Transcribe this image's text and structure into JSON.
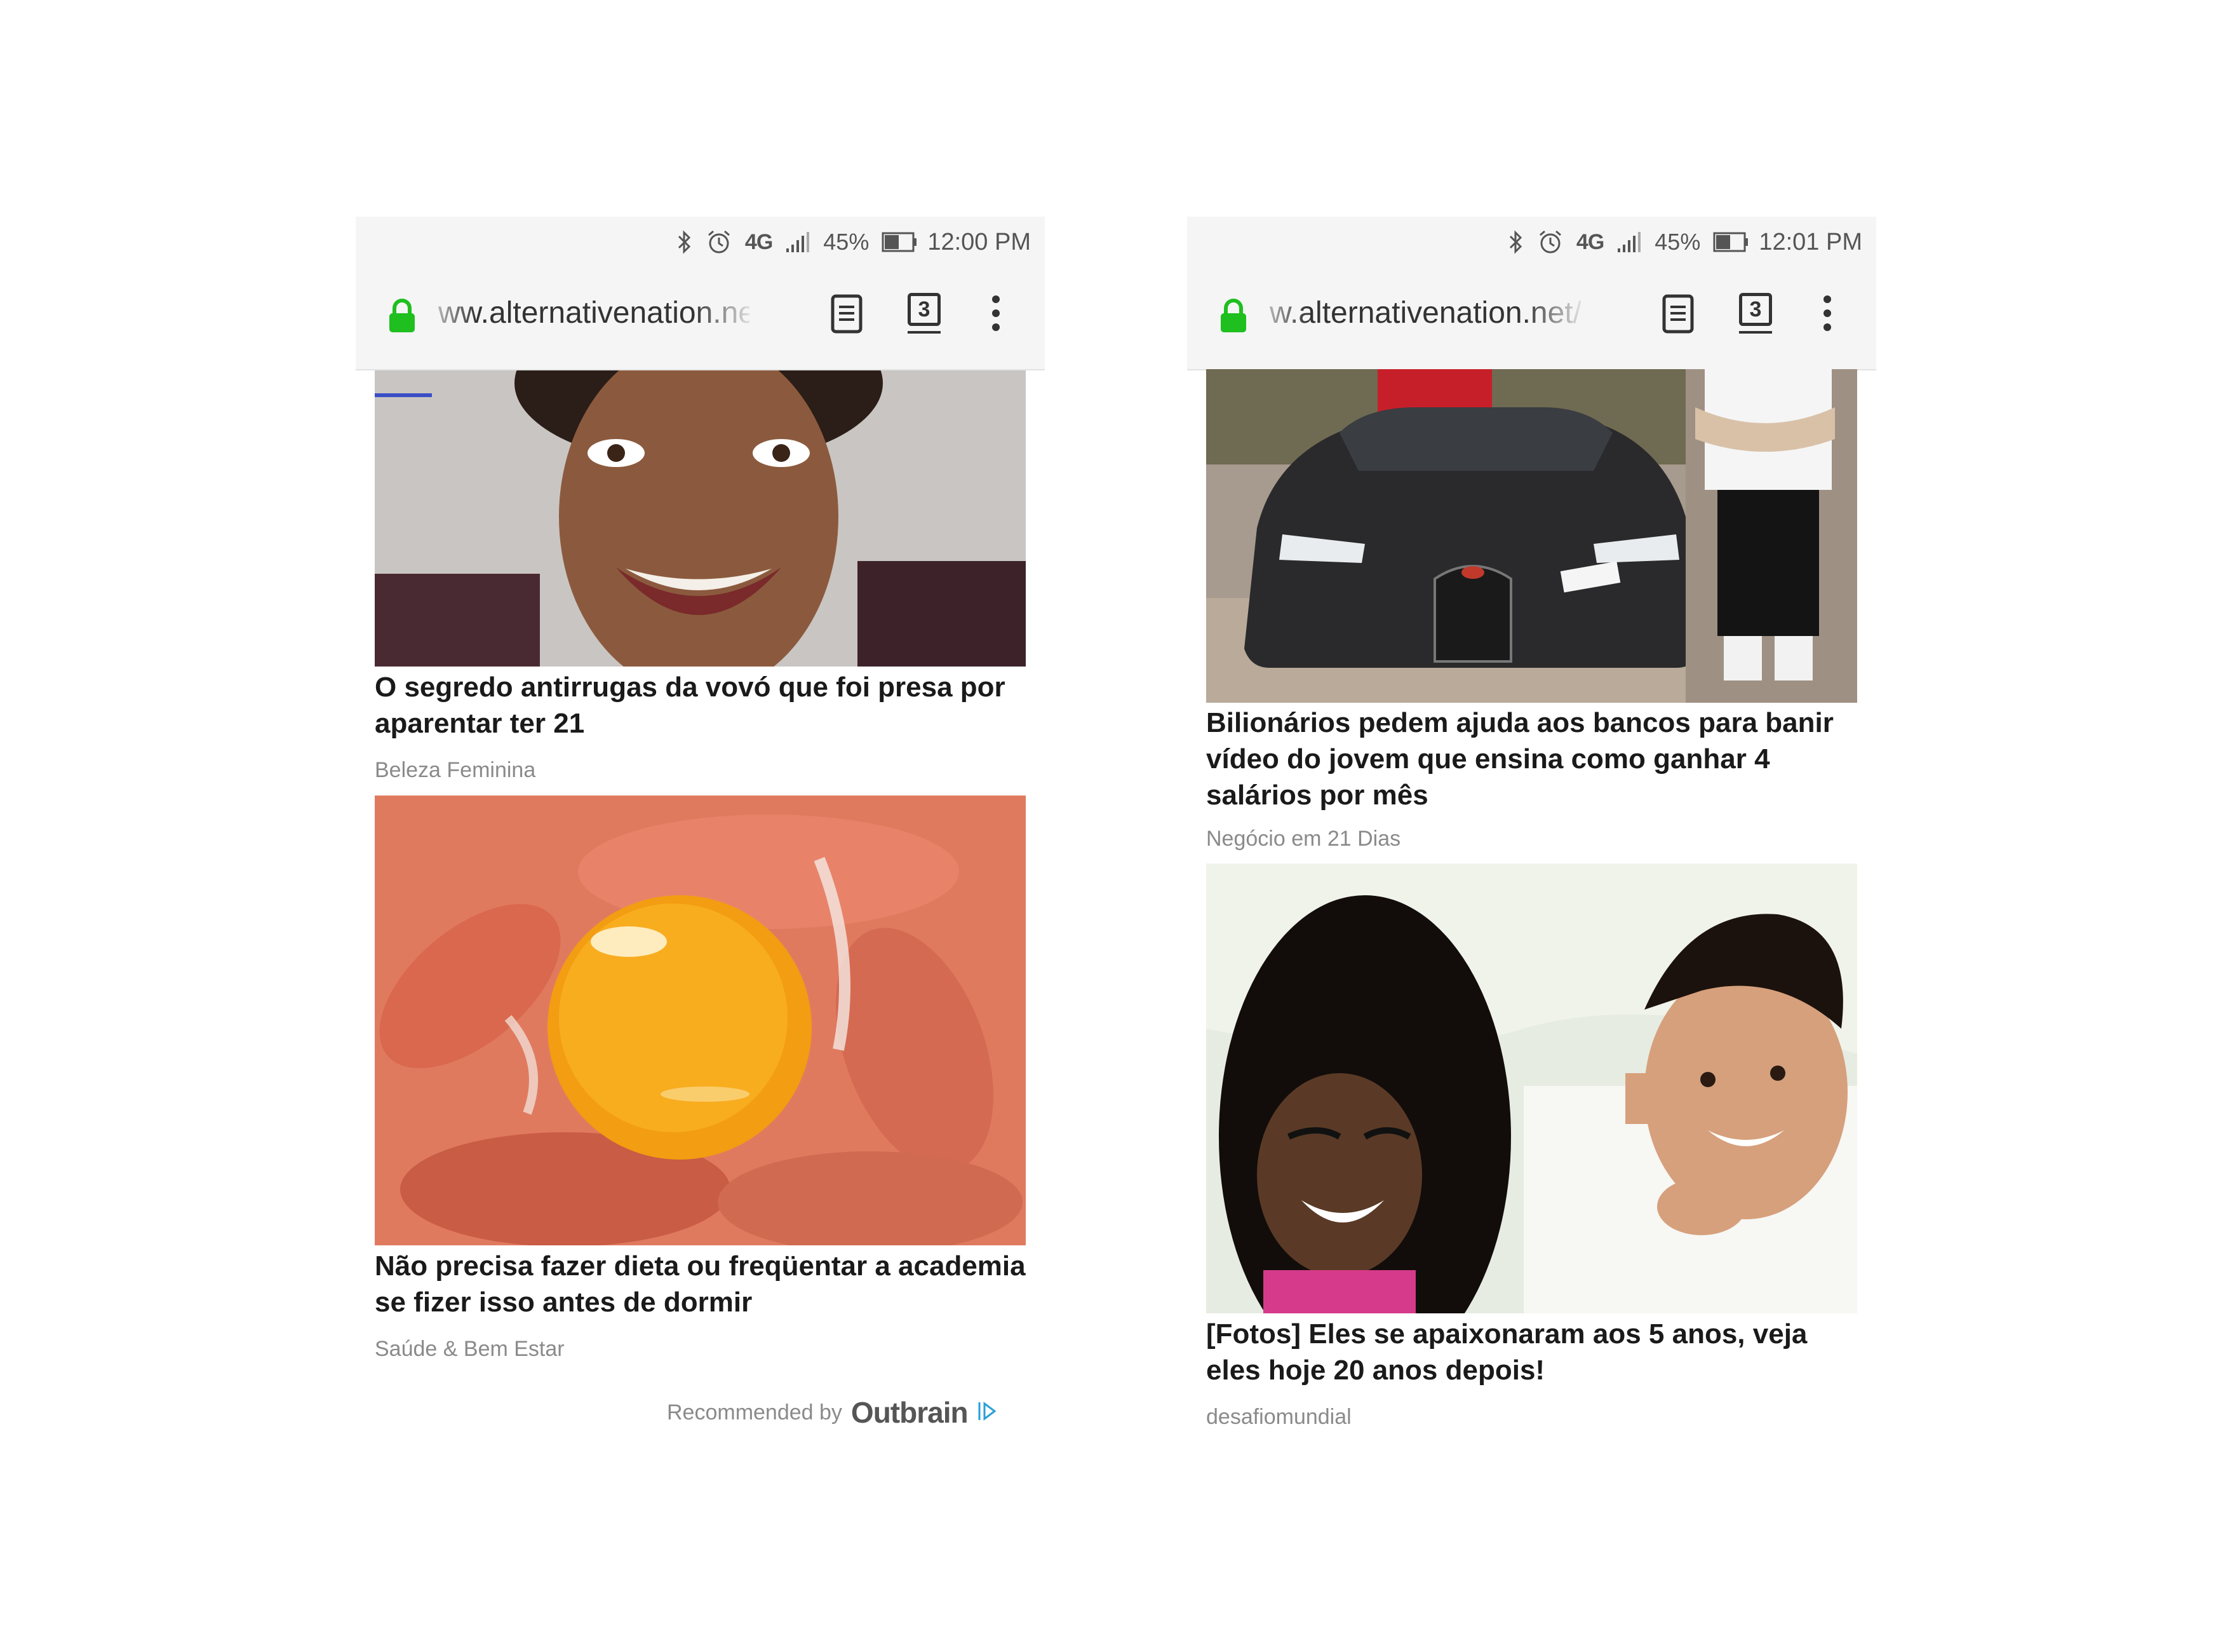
{
  "screens": [
    {
      "status": {
        "network": "4G",
        "battery": "45%",
        "time": "12:00 PM"
      },
      "url": {
        "prefix": "w.",
        "text": "ww.alternativenation.net/to"
      },
      "tab_count": "3",
      "articles": [
        {
          "title": "O segredo antirrugas da vovó que foi presa por aparentar ter 21",
          "source": "Beleza Feminina"
        },
        {
          "title": "Não precisa fazer dieta ou freqüentar a academia se fizer isso antes de dormir",
          "source": "Saúde & Bem Estar"
        }
      ],
      "recommended": {
        "label": "Recommended by",
        "brand": "Outbrain"
      }
    },
    {
      "status": {
        "network": "4G",
        "battery": "45%",
        "time": "12:01 PM"
      },
      "url": {
        "text": "w.alternativenation.net/bi"
      },
      "tab_count": "3",
      "articles": [
        {
          "title": "Bilionários pedem ajuda aos bancos para banir vídeo do jovem que ensina como ganhar 4 salários por mês",
          "source": "Negócio em 21 Dias"
        },
        {
          "title": "[Fotos] Eles se apaixonaram aos 5 anos, veja eles hoje 20 anos depois!",
          "source": "desafiomundial"
        }
      ]
    }
  ],
  "colors": {
    "lock": "#1fbf1f",
    "title": "#1a1a1a",
    "source": "#8a8a8a",
    "outbrain_accent": "#2a9fd6"
  }
}
